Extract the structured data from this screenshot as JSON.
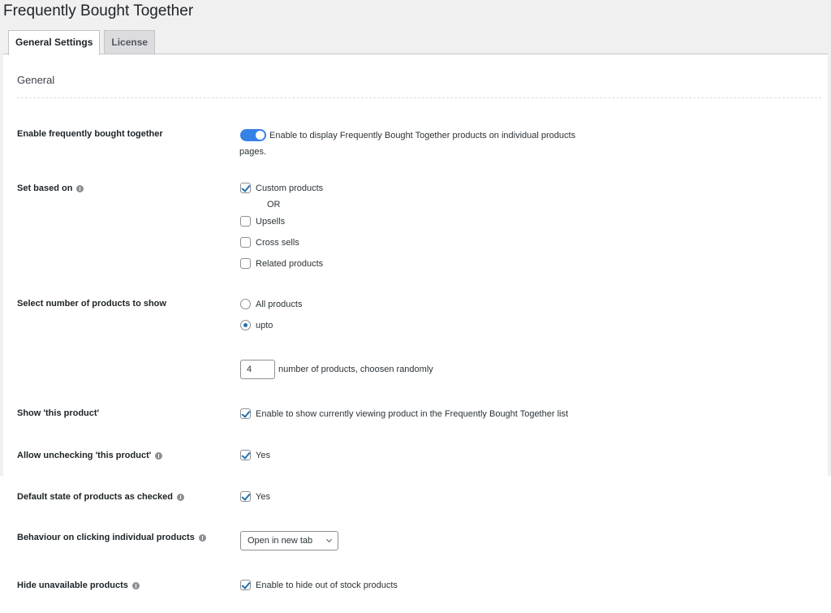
{
  "page": {
    "title": "Frequently Bought Together"
  },
  "tabs": [
    {
      "label": "General Settings",
      "active": true
    },
    {
      "label": "License",
      "active": false
    }
  ],
  "section": {
    "title": "General"
  },
  "settings": {
    "enable": {
      "label": "Enable frequently bought together",
      "toggle_on": true,
      "description_line1": "Enable to display Frequently Bought Together products on individual products",
      "description_line2": "pages."
    },
    "set_based_on": {
      "label": "Set based on",
      "options": [
        {
          "label": "Custom products",
          "checked": true
        },
        {
          "label": "Upsells",
          "checked": false
        },
        {
          "label": "Cross sells",
          "checked": false
        },
        {
          "label": "Related products",
          "checked": false
        }
      ],
      "separator": "OR"
    },
    "number_to_show": {
      "label": "Select number of products to show",
      "options": [
        {
          "label": "All products",
          "selected": false
        },
        {
          "label": "upto",
          "selected": true
        }
      ],
      "count_value": "4",
      "count_suffix": "number of products, choosen randomly"
    },
    "show_this_product": {
      "label": "Show 'this product'",
      "checked": true,
      "description": "Enable to show currently viewing product in the Frequently Bought Together list"
    },
    "allow_unchecking": {
      "label": "Allow unchecking 'this product'",
      "checked": true,
      "description": "Yes"
    },
    "default_checked": {
      "label": "Default state of products as checked",
      "checked": true,
      "description": "Yes"
    },
    "behaviour": {
      "label": "Behaviour on clicking individual products",
      "selected": "Open in new tab"
    },
    "hide_unavailable": {
      "label": "Hide unavailable products",
      "checked": true,
      "description": "Enable to hide out of stock products"
    }
  },
  "colors": {
    "accent": "#2271b1",
    "toggle": "#3582e6"
  }
}
